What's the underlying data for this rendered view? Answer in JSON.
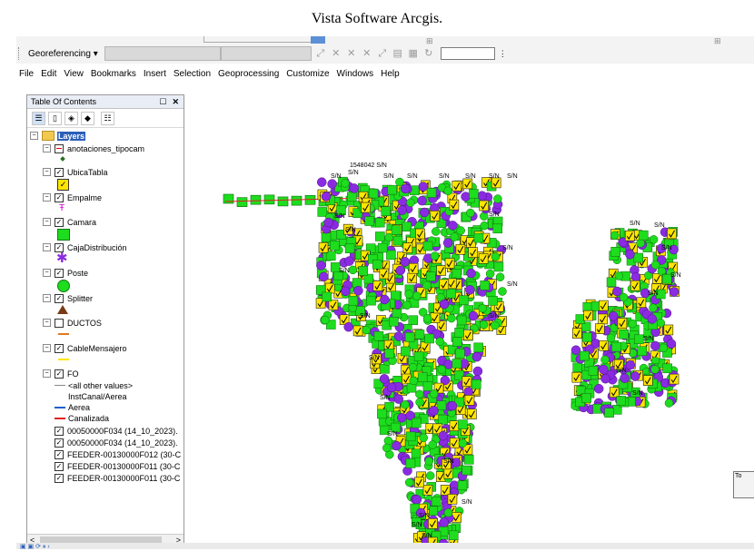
{
  "caption": "Vista Software Arcgis.",
  "toolbar": {
    "georeferencing": "Georeferencing ▾"
  },
  "menu": [
    "File",
    "Edit",
    "View",
    "Bookmarks",
    "Insert",
    "Selection",
    "Geoprocessing",
    "Customize",
    "Windows",
    "Help"
  ],
  "toc": {
    "title": "Table Of Contents",
    "root": "Layers",
    "layers": [
      {
        "name": "anotaciones_tipocam",
        "symbol": "diamond-dot"
      },
      {
        "name": "UbicaTabla",
        "symbol": "yellow-check"
      },
      {
        "name": "Empalme",
        "symbol": "magenta-pin"
      },
      {
        "name": "Camara",
        "symbol": "green-square"
      },
      {
        "name": "CajaDistribución",
        "symbol": "purple-star"
      },
      {
        "name": "Poste",
        "symbol": "green-circle"
      },
      {
        "name": "Splitter",
        "symbol": "brown-triangle"
      },
      {
        "name": "DUCTOS",
        "symbol": "orange-dash"
      },
      {
        "name": "CableMensajero",
        "symbol": "yellow-line"
      },
      {
        "name": "FO",
        "symbol": "none"
      }
    ],
    "fo_items": [
      "<all other values>",
      "InstCanal/Aerea",
      "Aerea",
      "Canalizada"
    ],
    "extra_layers": [
      "00050000F034 (14_10_2023).",
      "00050000F034 (14_10_2023).",
      "FEEDER-00130000F012 (30-C",
      "FEEDER-00130000F011 (30-C",
      "FEEDER-00130000F011 (30-C"
    ]
  },
  "map": {
    "point_label": "1548042 S/N",
    "short_label": "S/N",
    "colors": {
      "green": "#1edc1e",
      "purple": "#8a2be2",
      "yellow": "#ffe600",
      "red": "#e02020"
    }
  }
}
